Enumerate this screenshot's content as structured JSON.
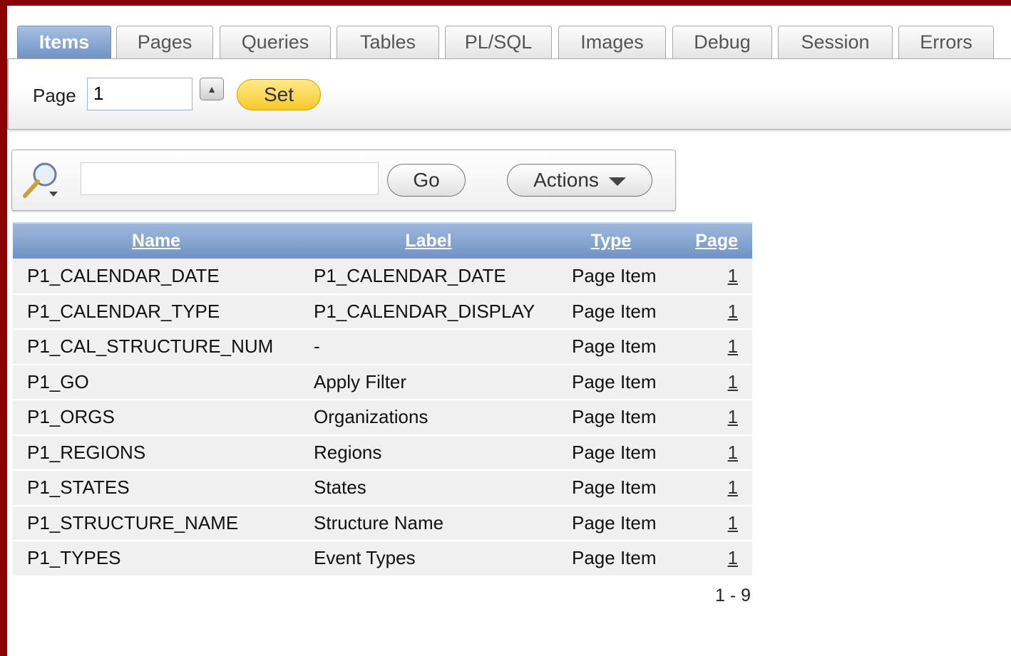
{
  "tabs": [
    {
      "label": "Items",
      "active": true
    },
    {
      "label": "Pages"
    },
    {
      "label": "Queries"
    },
    {
      "label": "Tables"
    },
    {
      "label": "PL/SQL"
    },
    {
      "label": "Images"
    },
    {
      "label": "Debug"
    },
    {
      "label": "Session"
    },
    {
      "label": "Errors"
    }
  ],
  "page_selector": {
    "label": "Page",
    "value": "1",
    "set_label": "Set"
  },
  "search": {
    "value": "",
    "go_label": "Go",
    "actions_label": "Actions"
  },
  "table": {
    "headers": {
      "name": "Name",
      "label": "Label",
      "type": "Type",
      "page": "Page"
    },
    "rows": [
      {
        "name": "P1_CALENDAR_DATE",
        "label": "P1_CALENDAR_DATE",
        "type": "Page Item",
        "page": "1"
      },
      {
        "name": "P1_CALENDAR_TYPE",
        "label": "P1_CALENDAR_DISPLAY",
        "type": "Page Item",
        "page": "1"
      },
      {
        "name": "P1_CAL_STRUCTURE_NUM",
        "label": "-",
        "type": "Page Item",
        "page": "1"
      },
      {
        "name": "P1_GO",
        "label": "Apply Filter",
        "type": "Page Item",
        "page": "1"
      },
      {
        "name": "P1_ORGS",
        "label": "Organizations",
        "type": "Page Item",
        "page": "1"
      },
      {
        "name": "P1_REGIONS",
        "label": "Regions",
        "type": "Page Item",
        "page": "1"
      },
      {
        "name": "P1_STATES",
        "label": "States",
        "type": "Page Item",
        "page": "1"
      },
      {
        "name": "P1_STRUCTURE_NAME",
        "label": "Structure Name",
        "type": "Page Item",
        "page": "1"
      },
      {
        "name": "P1_TYPES",
        "label": "Event Types",
        "type": "Page Item",
        "page": "1"
      }
    ]
  },
  "pagination": "1 - 9",
  "colors": {
    "frame": "#8b0000",
    "active_tab": "#6f93c4",
    "set_button": "#f7c92a",
    "header": "#6f92c4"
  }
}
